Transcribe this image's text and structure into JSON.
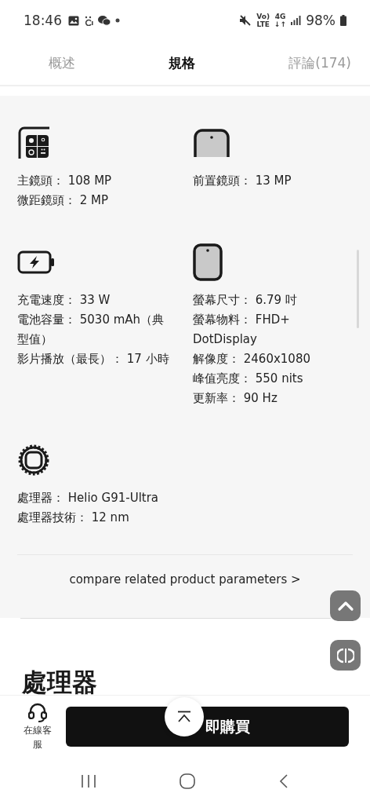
{
  "status_bar": {
    "time": "18:46",
    "volte": [
      "Vo)",
      "LTE"
    ],
    "data": [
      "4G",
      "↓↑"
    ],
    "battery": "98%"
  },
  "tabs": [
    {
      "label": "概述",
      "selected": false
    },
    {
      "label": "規格",
      "selected": true
    },
    {
      "label": "評論(174)",
      "selected": false
    }
  ],
  "specs": [
    {
      "kind": "rear_camera",
      "lines": [
        "主鏡頭： 108 MP",
        "微距鏡頭： 2 MP"
      ]
    },
    {
      "kind": "front_camera",
      "lines": [
        "前置鏡頭： 13 MP"
      ]
    },
    {
      "kind": "battery",
      "lines": [
        "充電速度： 33 W",
        "電池容量： 5030 mAh（典型值）",
        "影片播放（最長）： 17 小時"
      ]
    },
    {
      "kind": "screen",
      "lines": [
        "螢幕尺寸： 6.79 吋",
        "螢幕物料： FHD+ DotDisplay",
        "解像度： 2460x1080",
        "峰值亮度： 550 nits",
        "更新率： 90 Hz"
      ]
    },
    {
      "kind": "chip",
      "lines": [
        "處理器： Helio G91-Ultra",
        "處理器技術： 12 nm"
      ]
    }
  ],
  "compare_link": "compare related product parameters >",
  "section_heading": "處理器",
  "bottom_bar": {
    "service_label": "在線客服",
    "buy_button": "即購買"
  }
}
